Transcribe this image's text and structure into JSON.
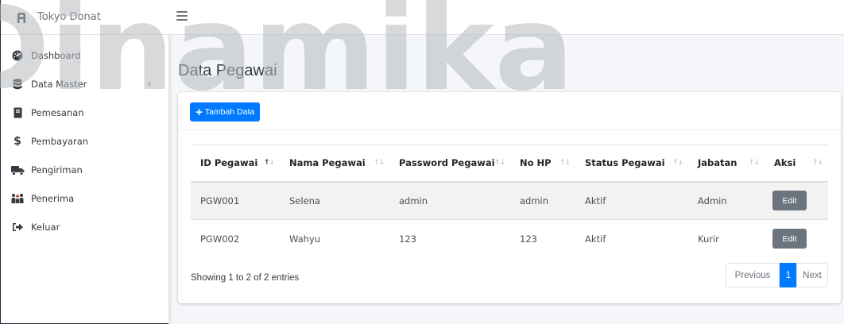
{
  "brand": {
    "name": "Tokyo Donat",
    "icon": "a-logo-icon"
  },
  "watermark": {
    "text": "Dinamika",
    "color": "#b7b9bd"
  },
  "sidebar": {
    "items": [
      {
        "label": "Dashboard",
        "icon": "dashboard-icon"
      },
      {
        "label": "Data Master",
        "icon": "database-icon",
        "chevron": "‹"
      },
      {
        "label": "Pemesanan",
        "icon": "book-icon"
      },
      {
        "label": "Pembayaran",
        "icon": "dollar-icon"
      },
      {
        "label": "Pengiriman",
        "icon": "truck-icon"
      },
      {
        "label": "Penerima",
        "icon": "people-icon"
      },
      {
        "label": "Keluar",
        "icon": "sign-out-icon"
      }
    ]
  },
  "page": {
    "title": "Data Pegawai"
  },
  "toolbar": {
    "add_label": "Tambah Data",
    "add_color": "#007bff"
  },
  "table": {
    "columns": [
      "ID Pegawai",
      "Nama Pegawai",
      "Password Pegawai",
      "No HP",
      "Status Pegawai",
      "Jabatan",
      "Aksi"
    ],
    "rows": [
      {
        "id": "PGW001",
        "nama": "Selena",
        "password": "admin",
        "hp": "admin",
        "status": "Aktif",
        "jabatan": "Admin",
        "action": "Edit"
      },
      {
        "id": "PGW002",
        "nama": "Wahyu",
        "password": "123",
        "hp": "123",
        "status": "Aktif",
        "jabatan": "Kurir",
        "action": "Edit"
      }
    ]
  },
  "footer": {
    "info": "Showing 1 to 2 of 2 entries",
    "prev": "Previous",
    "current": "1",
    "next": "Next"
  }
}
